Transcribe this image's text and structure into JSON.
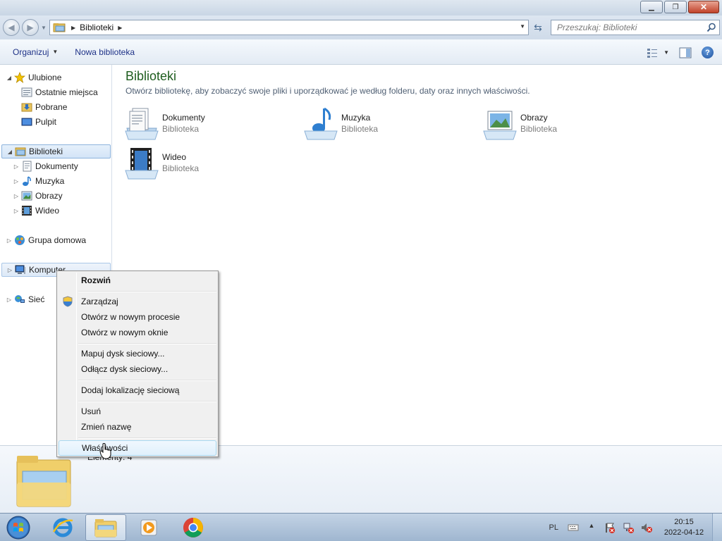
{
  "window": {
    "minimize_label": "▁",
    "restore_label": "❐",
    "close_label": "✕"
  },
  "address": {
    "crumbs": [
      "Biblioteki"
    ],
    "search_placeholder": "Przeszukaj: Biblioteki"
  },
  "toolbar": {
    "organize": "Organizuj",
    "new_library": "Nowa biblioteka"
  },
  "sidebar": {
    "favorites": "Ulubione",
    "favorites_items": [
      "Ostatnie miejsca",
      "Pobrane",
      "Pulpit"
    ],
    "libraries": "Biblioteki",
    "libraries_items": [
      "Dokumenty",
      "Muzyka",
      "Obrazy",
      "Wideo"
    ],
    "homegroup": "Grupa domowa",
    "computer": "Komputer",
    "network": "Sieć"
  },
  "main": {
    "title": "Biblioteki",
    "subtitle": "Otwórz bibliotekę, aby zobaczyć swoje pliki i uporządkować je według folderu, daty oraz innych właściwości.",
    "libraries": [
      {
        "name": "Dokumenty",
        "type": "Biblioteka",
        "icon": "documents-library-icon"
      },
      {
        "name": "Muzyka",
        "type": "Biblioteka",
        "icon": "music-library-icon"
      },
      {
        "name": "Obrazy",
        "type": "Biblioteka",
        "icon": "pictures-library-icon"
      },
      {
        "name": "Wideo",
        "type": "Biblioteka",
        "icon": "videos-library-icon"
      }
    ]
  },
  "details": {
    "count": "Elementy: 4"
  },
  "context_menu": {
    "items": [
      {
        "label": "Rozwiń",
        "bold": true
      },
      {
        "label": "Zarządzaj",
        "icon": "shield-icon"
      },
      {
        "label": "Otwórz w nowym procesie"
      },
      {
        "label": "Otwórz w nowym oknie"
      },
      {
        "label": "Mapuj dysk sieciowy..."
      },
      {
        "label": "Odłącz dysk sieciowy..."
      },
      {
        "label": "Dodaj lokalizację sieciową"
      },
      {
        "label": "Usuń"
      },
      {
        "label": "Zmień nazwę"
      },
      {
        "label": "Właściwości",
        "highlighted": true
      }
    ]
  },
  "taskbar": {
    "apps": [
      "internet-explorer-icon",
      "windows-explorer-icon",
      "media-player-icon",
      "chrome-icon"
    ],
    "language": "PL",
    "time": "20:15",
    "date": "2022-04-12"
  },
  "colors": {
    "title_green": "#1e5d1e",
    "link_blue": "#1e3287",
    "selection_border": "#8cb3dd"
  }
}
